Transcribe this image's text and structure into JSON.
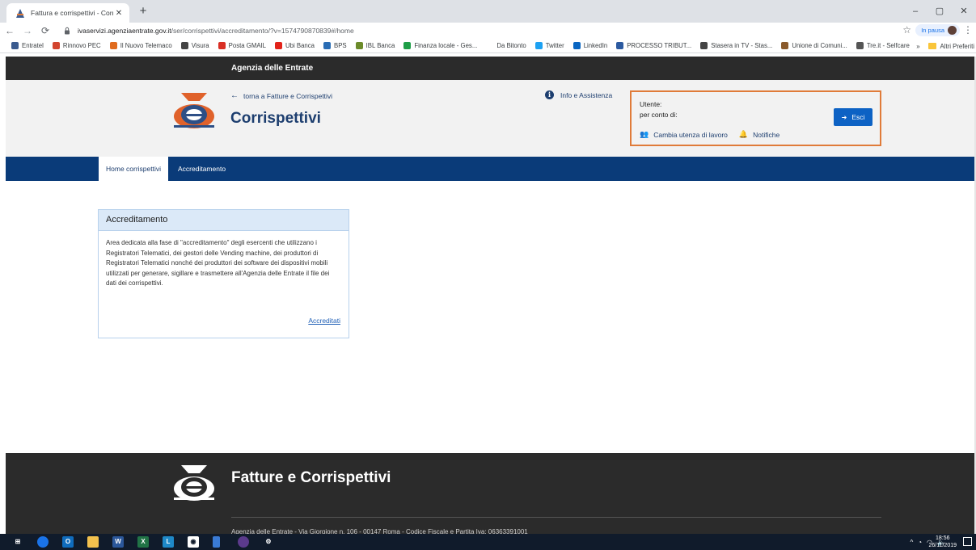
{
  "browser": {
    "tab_title": "Fattura e corrispettivi - Corrispet",
    "tab_close": "✕",
    "new_tab": "+",
    "url_host": "ivaservizi.agenziaentrate.gov.it",
    "url_path": "/ser/corrispettivi/accreditamento/?v=1574790870839#/home",
    "profile_label": "In pausa",
    "window_controls": [
      "–",
      "▢",
      "✕"
    ]
  },
  "bookmarks": {
    "items": [
      {
        "label": "Entratel",
        "icon": "agency-icon",
        "color": "#3b5b8f"
      },
      {
        "label": "Rinnovo PEC",
        "icon": "pec-icon",
        "color": "#d2452f"
      },
      {
        "label": "Il Nuovo Telemaco",
        "icon": "telemaco-icon",
        "color": "#e06b1e"
      },
      {
        "label": "Visura",
        "icon": "globe-icon",
        "color": "#444444"
      },
      {
        "label": "Posta GMAIL",
        "icon": "gmail-icon",
        "color": "#d93025"
      },
      {
        "label": "Ubi Banca",
        "icon": "ubi-icon",
        "color": "#e2231a"
      },
      {
        "label": "BPS",
        "icon": "bps-icon",
        "color": "#2a6db5"
      },
      {
        "label": "IBL Banca",
        "icon": "ibl-icon",
        "color": "#6c8b2a"
      },
      {
        "label": "Finanza locale - Ges...",
        "icon": "flag-icon",
        "color": "#1e9e47"
      },
      {
        "label": "Da Bitonto",
        "icon": "blank-icon",
        "color": "#ffffff"
      },
      {
        "label": "Twitter",
        "icon": "twitter-icon",
        "color": "#1da1f2"
      },
      {
        "label": "LinkedIn",
        "icon": "linkedin-icon",
        "color": "#0a66c2"
      },
      {
        "label": "PROCESSO TRIBUT...",
        "icon": "scale-icon",
        "color": "#2c5aa0"
      },
      {
        "label": "Stasera in TV - Stas...",
        "icon": "globe-icon",
        "color": "#444444"
      },
      {
        "label": "Unione di Comuni...",
        "icon": "unione-icon",
        "color": "#8a5a2b"
      },
      {
        "label": "Tre.it - Selfcare",
        "icon": "tre-icon",
        "color": "#555555"
      }
    ],
    "more": "»",
    "other_favorites": "Altri Preferiti"
  },
  "page": {
    "agency_bar": "Agenzia delle Entrate",
    "back_link": "torna a Fatture e Corrispettivi",
    "title": "Corrispettivi",
    "info_link": "Info e Assistenza",
    "user": {
      "utente_label": "Utente:",
      "per_conto_label": "per conto di:",
      "exit_label": "Esci",
      "change_label": "Cambia utenza di lavoro",
      "notifications_label": "Notifiche"
    },
    "tabs": [
      {
        "label": "Home corrispettivi",
        "active": true
      },
      {
        "label": "Accreditamento",
        "active": false
      }
    ],
    "card": {
      "title": "Accreditamento",
      "body": "Area dedicata alla fase di \"accreditamento\" degli esercenti che utilizzano i Registratori Telematici, dei gestori delle Vending machine, dei produttori di Registratori Telematici nonché dei produttori dei software dei dispositivi mobili utilizzati per generare, sigillare e trasmettere all'Agenzia delle Entrate il file dei dati dei corrispettivi.",
      "link": "Accreditati"
    },
    "footer": {
      "title": "Fatture e Corrispettivi",
      "address": "Agenzia delle Entrate - Via Giorgione n. 106 - 00147 Roma - Codice Fiscale e Partita Iva: 06363391001"
    }
  },
  "taskbar": {
    "clock_time": "18:56",
    "clock_date": "26/11/2019"
  },
  "colors": {
    "brand_navy": "#0a3b79",
    "title_blue": "#1d3e6f",
    "accent_orange": "#e07b39",
    "button_blue": "#0d62c4"
  }
}
